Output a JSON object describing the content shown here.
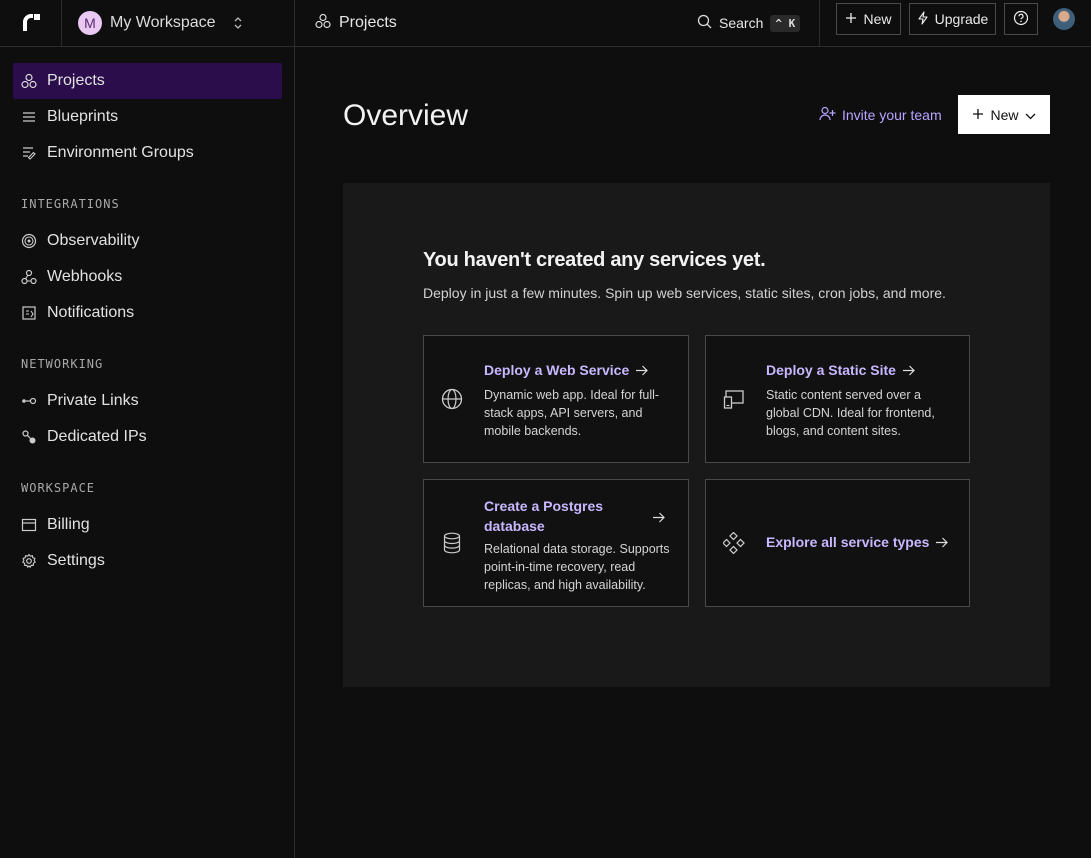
{
  "topbar": {
    "workspace_initial": "M",
    "workspace_name": "My Workspace",
    "breadcrumb": "Projects",
    "search_label": "Search",
    "search_kbd": "^ K",
    "new_label": "New",
    "upgrade_label": "Upgrade",
    "help_label": "?"
  },
  "sidebar": {
    "items": [
      {
        "label": "Projects",
        "icon": "projects-icon",
        "active": true
      },
      {
        "label": "Blueprints",
        "icon": "list-icon"
      },
      {
        "label": "Environment Groups",
        "icon": "env-groups-icon"
      }
    ],
    "integrations_label": "INTEGRATIONS",
    "integrations": [
      {
        "label": "Observability",
        "icon": "observability-icon"
      },
      {
        "label": "Webhooks",
        "icon": "webhook-icon"
      },
      {
        "label": "Notifications",
        "icon": "notifications-icon"
      }
    ],
    "networking_label": "NETWORKING",
    "networking": [
      {
        "label": "Private Links",
        "icon": "private-link-icon"
      },
      {
        "label": "Dedicated IPs",
        "icon": "dedicated-ip-icon"
      }
    ],
    "workspace_label": "WORKSPACE",
    "workspace": [
      {
        "label": "Billing",
        "icon": "billing-icon"
      },
      {
        "label": "Settings",
        "icon": "gear-icon"
      }
    ]
  },
  "main": {
    "title": "Overview",
    "invite_label": "Invite your team",
    "new_label": "New",
    "empty_title": "You haven't created any services yet.",
    "empty_subtitle": "Deploy in just a few minutes. Spin up web services, static sites, cron jobs, and more.",
    "cards": [
      {
        "title": "Deploy a Web Service",
        "desc": "Dynamic web app. Ideal for full-stack apps, API servers, and mobile backends.",
        "icon": "globe-icon"
      },
      {
        "title": "Deploy a Static Site",
        "desc": "Static content served over a global CDN. Ideal for frontend, blogs, and content sites.",
        "icon": "static-site-icon"
      },
      {
        "title": "Create a Postgres database",
        "desc": "Relational data storage. Supports point-in-time recovery, read replicas, and high availability.",
        "icon": "database-icon"
      },
      {
        "title": "Explore all service types",
        "desc": "",
        "icon": "service-types-icon"
      }
    ]
  },
  "colors": {
    "accent": "#c9b7ff",
    "active_nav": "#2a0d4a",
    "background": "#0e0e0e",
    "panel": "#191919"
  }
}
